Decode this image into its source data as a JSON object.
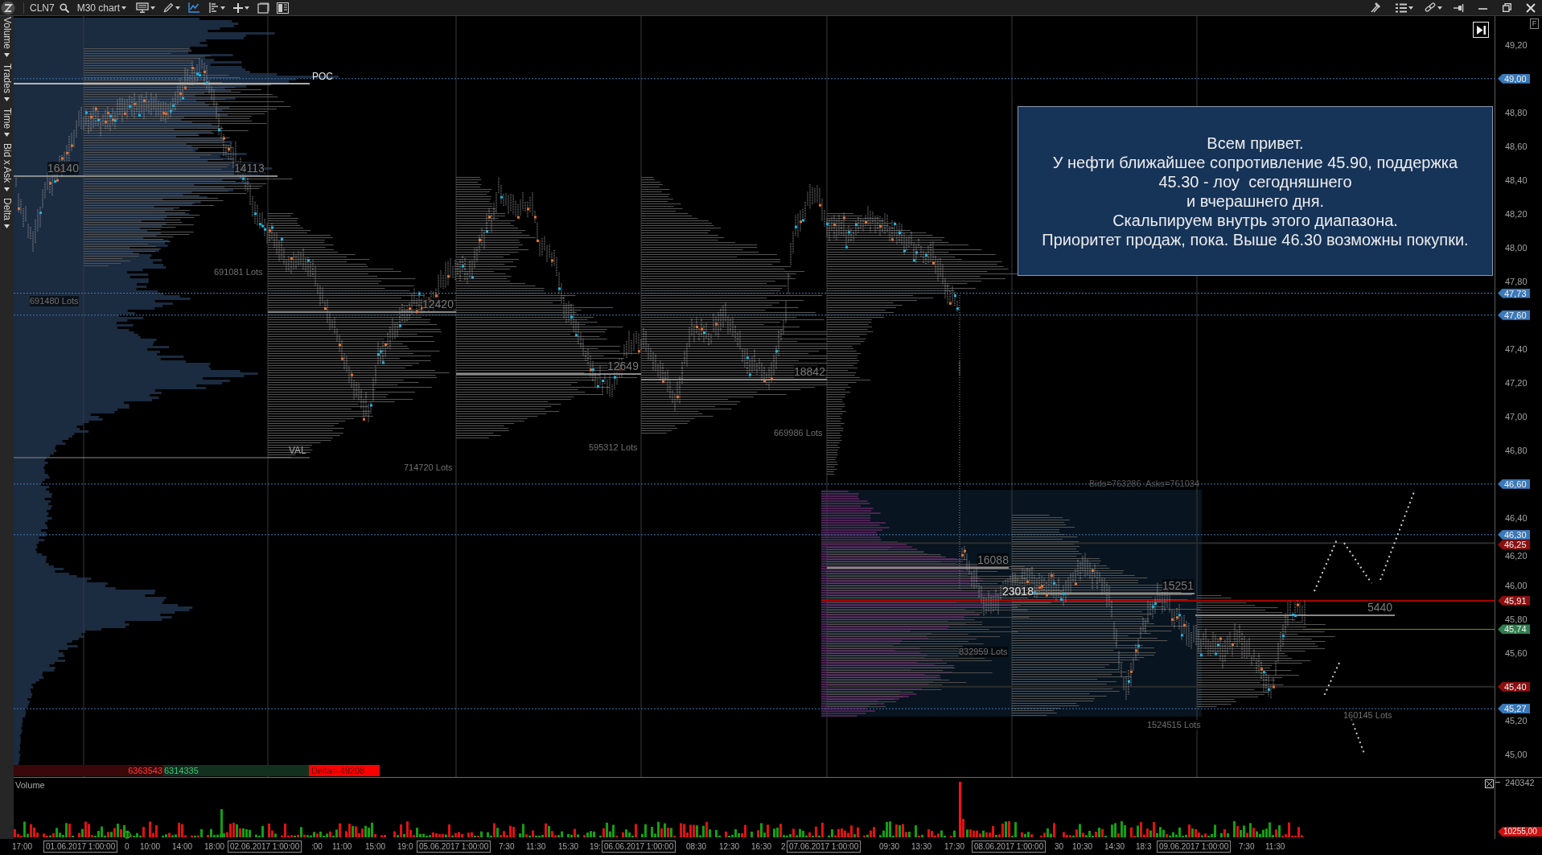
{
  "toolbar": {
    "symbol": "CLN7",
    "timeframe": "M30 chart",
    "line_tool": {
      "active": true
    }
  },
  "side_tabs": [
    "Volume",
    "Trades",
    "Time",
    "Bid x Ask",
    "Delta"
  ],
  "chart": {
    "labels": [
      {
        "text": "POC",
        "kind": "poc"
      },
      {
        "text": "16140",
        "kind": "cluster"
      },
      {
        "text": "14113",
        "kind": "cluster"
      },
      {
        "text": "691081 Lots",
        "kind": "lots"
      },
      {
        "text": "691480 Lots",
        "kind": "lots"
      },
      {
        "text": "12420",
        "kind": "cluster"
      },
      {
        "text": "12649",
        "kind": "cluster"
      },
      {
        "text": "18842",
        "kind": "cluster"
      },
      {
        "text": "669986 Lots",
        "kind": "lots"
      },
      {
        "text": "595312 Lots",
        "kind": "lots"
      },
      {
        "text": "VAL",
        "kind": "val"
      },
      {
        "text": "714720 Lots",
        "kind": "lots"
      },
      {
        "text": "Bids=763286  Asks=761034",
        "kind": "totals"
      },
      {
        "text": "16088",
        "kind": "cluster"
      },
      {
        "text": "23018",
        "kind": "max"
      },
      {
        "text": "15251",
        "kind": "cluster"
      },
      {
        "text": "5440",
        "kind": "cluster"
      },
      {
        "text": "832959 Lots",
        "kind": "lots"
      },
      {
        "text": "160145 Lots",
        "kind": "lots"
      },
      {
        "text": "1524515 Lots",
        "kind": "lots"
      }
    ],
    "annotation": {
      "lines": [
        "Всем привет.",
        "У нефти ближайшее сопротивление 45.90, поддержка",
        "45.30 - лоу  сегодняшнего",
        "и вчерашнего дня.",
        "Скальпируем внутрь этого диапазона.",
        "Приоритет продаж, пока. Выше 46.30 возможны покупки."
      ]
    },
    "delta_bar": {
      "sells": "6363543",
      "buys": "6314335",
      "delta": "Delta=-49208"
    }
  },
  "price_axis": {
    "button": "F",
    "labels": [
      {
        "text": "49,20",
        "kind": "tick"
      },
      {
        "text": "49,00",
        "kind": "marker",
        "color": "#3a78b8"
      },
      {
        "text": "48,80",
        "kind": "tick"
      },
      {
        "text": "48,60",
        "kind": "tick"
      },
      {
        "text": "48,40",
        "kind": "tick"
      },
      {
        "text": "48,20",
        "kind": "tick"
      },
      {
        "text": "48,00",
        "kind": "tick"
      },
      {
        "text": "47,80",
        "kind": "tick"
      },
      {
        "text": "47,73",
        "kind": "marker",
        "color": "#3a78b8"
      },
      {
        "text": "47,60",
        "kind": "marker",
        "color": "#3a78b8"
      },
      {
        "text": "47,40",
        "kind": "tick"
      },
      {
        "text": "47,20",
        "kind": "tick"
      },
      {
        "text": "47,00",
        "kind": "tick"
      },
      {
        "text": "46,80",
        "kind": "tick"
      },
      {
        "text": "46,60",
        "kind": "marker",
        "color": "#3a78b8"
      },
      {
        "text": "46,40",
        "kind": "tick"
      },
      {
        "text": "46,30",
        "kind": "marker",
        "color": "#3a78b8"
      },
      {
        "text": "46,25",
        "kind": "marker",
        "color": "#8a1010"
      },
      {
        "text": "46,20",
        "kind": "tick"
      },
      {
        "text": "46,00",
        "kind": "tick"
      },
      {
        "text": "45,91",
        "kind": "marker",
        "color": "#8a1010"
      },
      {
        "text": "45,80",
        "kind": "tick"
      },
      {
        "text": "45,74",
        "kind": "marker",
        "color": "#2f7f4f"
      },
      {
        "text": "45,60",
        "kind": "tick"
      },
      {
        "text": "45,40",
        "kind": "marker",
        "color": "#8a1010"
      },
      {
        "text": "45,27",
        "kind": "marker",
        "color": "#3a78b8"
      },
      {
        "text": "45,20",
        "kind": "tick"
      },
      {
        "text": "45,00",
        "kind": "tick"
      }
    ]
  },
  "volume_pane": {
    "title": "Volume",
    "axis_label": "240342",
    "marker": {
      "text": "10255,00",
      "color": "#d01010"
    }
  },
  "time_axis": [
    {
      "text": "17:00",
      "kind": "time"
    },
    {
      "text": "01.06.2017 1:00:00",
      "kind": "date"
    },
    {
      "text": "0",
      "kind": "time"
    },
    {
      "text": "10:00",
      "kind": "time"
    },
    {
      "text": "14:00",
      "kind": "time"
    },
    {
      "text": "18:00",
      "kind": "time"
    },
    {
      "text": "02.06.2017 1:00:00",
      "kind": "date"
    },
    {
      "text": ":00",
      "kind": "time"
    },
    {
      "text": "11:00",
      "kind": "time"
    },
    {
      "text": "15:00",
      "kind": "time"
    },
    {
      "text": "19:0",
      "kind": "time"
    },
    {
      "text": "05.06.2017 1:00:00",
      "kind": "date"
    },
    {
      "text": "7:30",
      "kind": "time"
    },
    {
      "text": "11:30",
      "kind": "time"
    },
    {
      "text": "15:30",
      "kind": "time"
    },
    {
      "text": "19:",
      "kind": "time"
    },
    {
      "text": "06.06.2017 1:00:00",
      "kind": "date"
    },
    {
      "text": "08:30",
      "kind": "time"
    },
    {
      "text": "12:30",
      "kind": "time"
    },
    {
      "text": "16:30",
      "kind": "time"
    },
    {
      "text": "2",
      "kind": "time"
    },
    {
      "text": "07.06.2017 1:00:00",
      "kind": "date"
    },
    {
      "text": "09:30",
      "kind": "time"
    },
    {
      "text": "13:30",
      "kind": "time"
    },
    {
      "text": "17:30",
      "kind": "time"
    },
    {
      "text": "08.06.2017 1:00:00",
      "kind": "date"
    },
    {
      "text": "30",
      "kind": "time"
    },
    {
      "text": "10:30",
      "kind": "time"
    },
    {
      "text": "14:30",
      "kind": "time"
    },
    {
      "text": "18:3",
      "kind": "time"
    },
    {
      "text": "09.06.2017 1:00:00",
      "kind": "date"
    },
    {
      "text": "7:30",
      "kind": "time"
    },
    {
      "text": "11:30",
      "kind": "time"
    }
  ]
}
